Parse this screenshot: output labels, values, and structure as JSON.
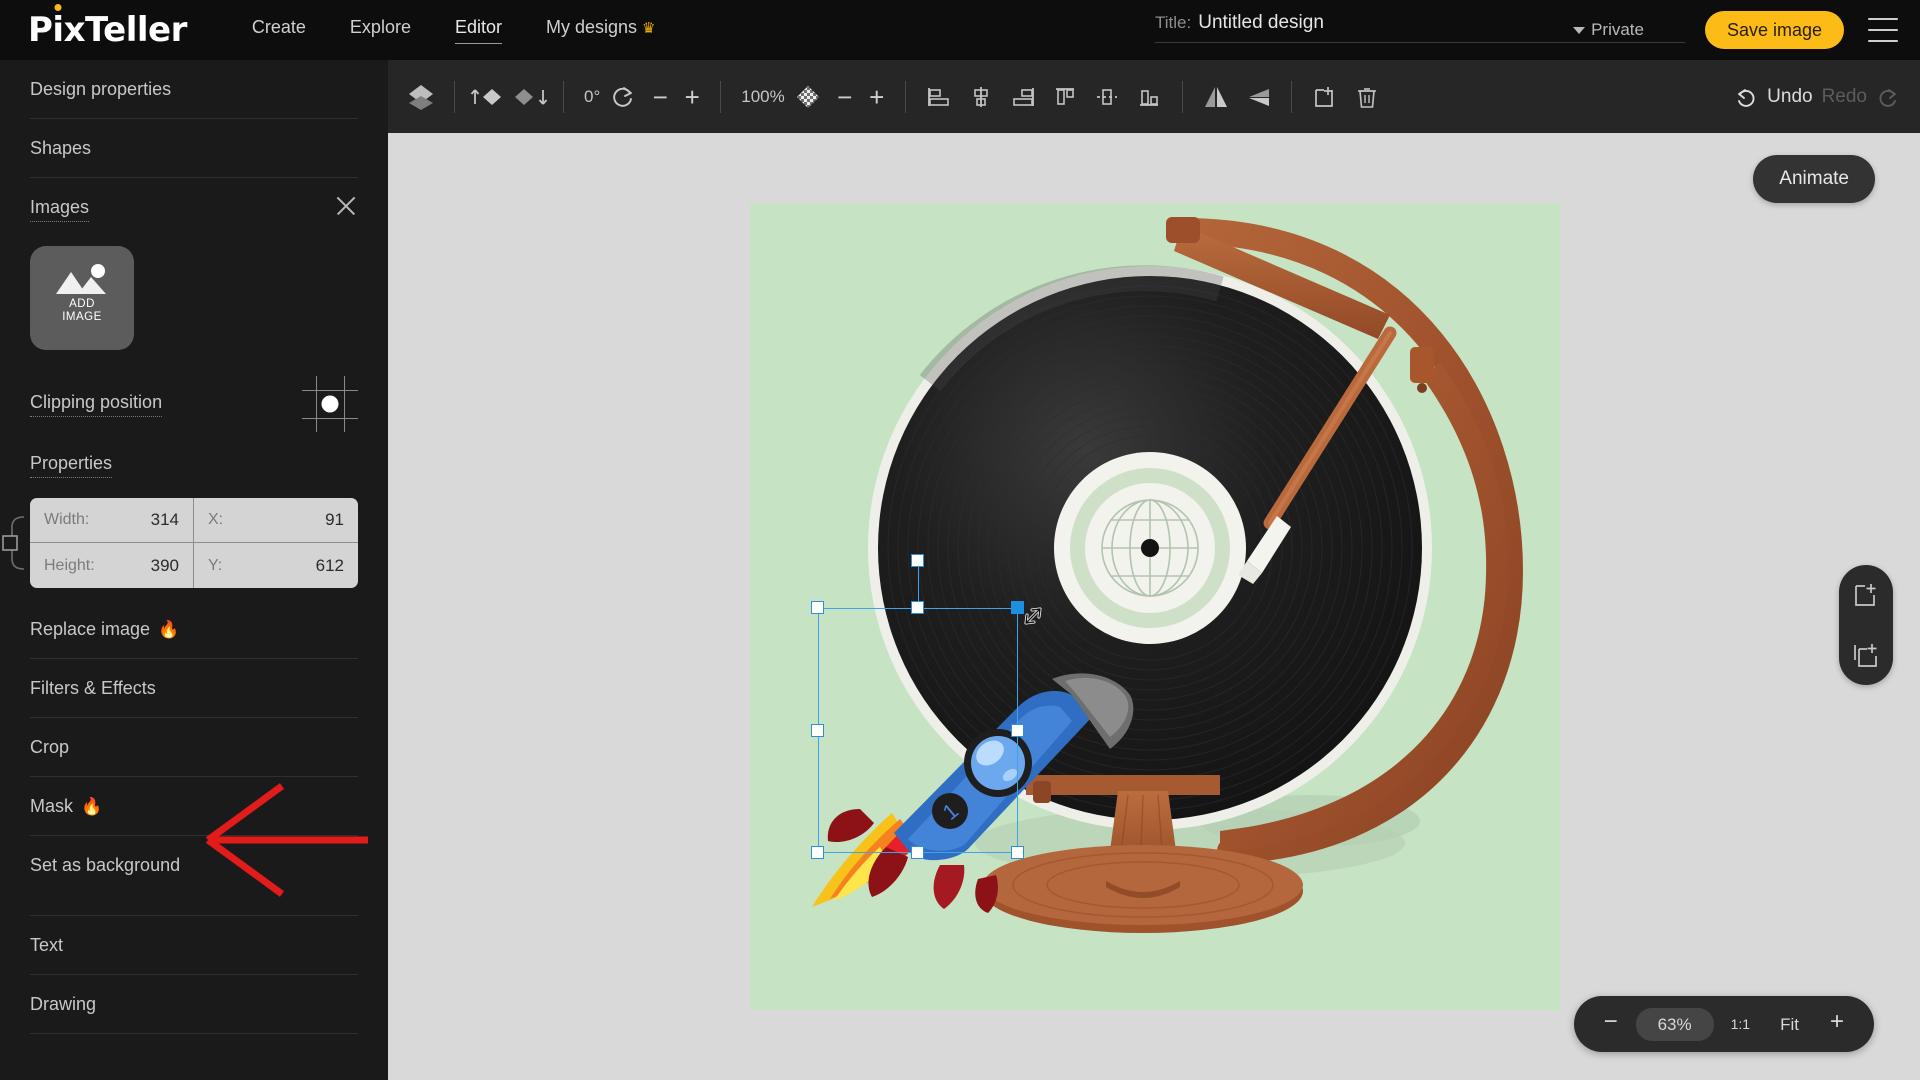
{
  "app": {
    "brand_prefix": "P",
    "brand_i": "i",
    "brand_suffix": "xTeller",
    "accent_yellow": "#fcbb16",
    "accent_red": "#e8252a",
    "selection_blue": "#3ea4e8",
    "canvas_background": "#c6e3c4",
    "workspace_background": "#d9d9d9"
  },
  "header": {
    "nav": [
      {
        "label": "Create",
        "active": false
      },
      {
        "label": "Explore",
        "active": false
      },
      {
        "label": "Editor",
        "active": true
      },
      {
        "label": "My designs",
        "active": false,
        "badge": "crown-icon"
      }
    ],
    "title_label": "Title:",
    "title_value": "Untitled design",
    "title_placeholder": "Untitled design",
    "privacy": "Private",
    "save_label": "Save image",
    "menu_icon": "hamburger-icon"
  },
  "toolbar": {
    "layers_icon": "layers-icon",
    "bring_forward_icon": "bring-forward-icon",
    "send_backward_icon": "send-backward-icon",
    "rotation_value": "0°",
    "rotation_minus": "−",
    "rotation_plus": "+",
    "opacity_value": "100%",
    "opacity_icon": "checkerboard-icon",
    "opacity_minus": "−",
    "opacity_plus": "+",
    "align": [
      "align-left-icon",
      "align-center-horizontal-icon",
      "align-right-icon",
      "align-top-icon",
      "align-middle-vertical-icon",
      "align-bottom-icon"
    ],
    "flip_horizontal_icon": "flip-horizontal-icon",
    "flip_vertical_icon": "flip-vertical-icon",
    "duplicate_icon": "duplicate-icon",
    "delete_icon": "trash-icon",
    "undo_label": "Undo",
    "redo_label": "Redo",
    "undo_enabled": true,
    "redo_enabled": false
  },
  "sidebar": {
    "items": [
      {
        "label": "Design properties"
      },
      {
        "label": "Shapes"
      },
      {
        "label": "Images",
        "open": true,
        "close_icon": "close-icon"
      }
    ],
    "add_image": {
      "line1": "ADD",
      "line2": "IMAGE",
      "icon": "image-placeholder-icon"
    },
    "clipping": {
      "label": "Clipping position",
      "grid_icon": "clipping-grid-icon"
    },
    "properties_label": "Properties",
    "properties": {
      "width_key": "Width:",
      "width_value": "314",
      "height_key": "Height:",
      "height_value": "390",
      "x_key": "X:",
      "x_value": "91",
      "y_key": "Y:",
      "y_value": "612",
      "lock_icon": "aspect-lock-icon"
    },
    "actions": [
      {
        "label": "Replace image",
        "flame": "🔥"
      },
      {
        "label": "Filters & Effects"
      },
      {
        "label": "Crop"
      },
      {
        "label": "Mask",
        "flame": "🔥"
      },
      {
        "label": "Set as background",
        "annotated": true
      }
    ],
    "bottom_items": [
      {
        "label": "Text"
      },
      {
        "label": "Drawing"
      }
    ]
  },
  "canvas": {
    "animate_label": "Animate",
    "add_page_icon": "add-page-icon",
    "duplicate_page_icon": "duplicate-page-icon",
    "zoom": {
      "minus": "−",
      "percent": "63%",
      "one_to_one": "1:1",
      "fit": "Fit",
      "plus": "+"
    },
    "selected_object": "rocket-image",
    "artwork": "vinyl-record-globe-illustration"
  }
}
